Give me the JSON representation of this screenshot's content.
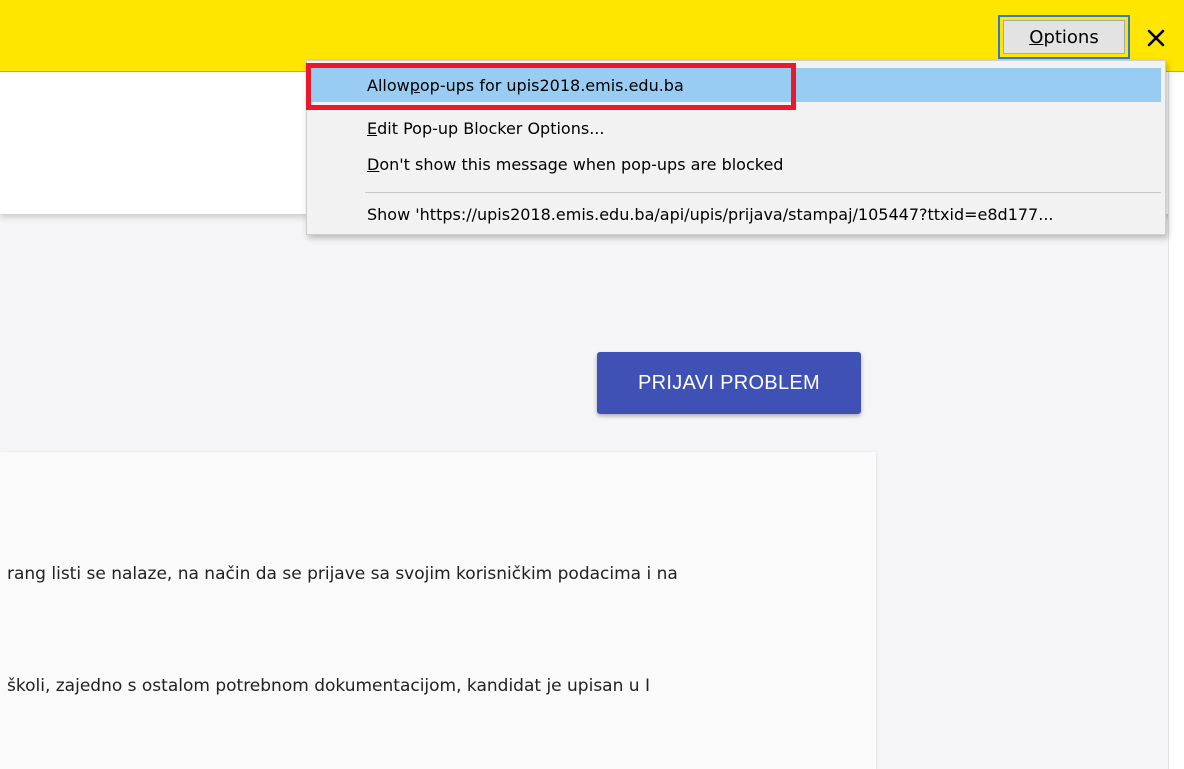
{
  "notification_bar": {
    "options_label_mnemonic": "O",
    "options_label_rest": "ptions",
    "close_glyph": "✕",
    "close_icon": "close-icon",
    "bg_color": "#ffe600"
  },
  "popup_menu": {
    "items": [
      {
        "pre": "Allow ",
        "mnemonic": "p",
        "post": "op-ups for upis2018.emis.edu.ba",
        "highlighted": true
      },
      {
        "pre": "",
        "mnemonic": "E",
        "post": "dit Pop-up Blocker Options...",
        "highlighted": false
      },
      {
        "pre": "",
        "mnemonic": "D",
        "post": "on't show this message when pop-ups are blocked",
        "highlighted": false
      },
      {
        "pre": "Show 'https://upis2018.emis.edu.ba/api/upis/prijava/stampaj/105447?ttxid=e8d177...",
        "mnemonic": "",
        "post": "",
        "highlighted": false
      }
    ],
    "highlight_color": "#99ccf3",
    "annotation_color": "#e8192c"
  },
  "page": {
    "report_button_label": "PRIJAVI PROBLEM",
    "report_button_color": "#3f51b5",
    "content_lines": [
      "rang listi se nalaze, na način da se prijave sa svojim korisničkim podacima i na",
      "školi, zajedno s ostalom potrebnom dokumentacijom, kandidat je upisan u I"
    ]
  }
}
